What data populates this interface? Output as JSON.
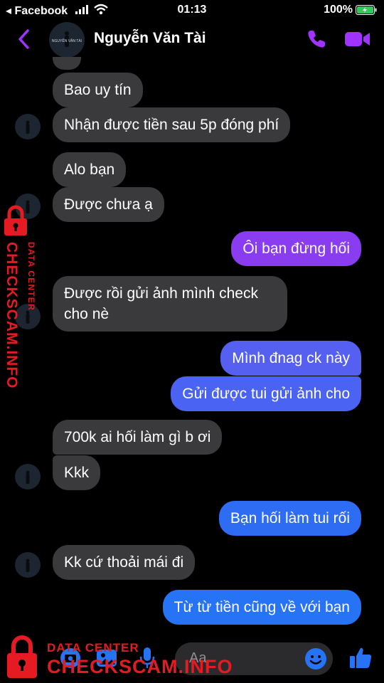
{
  "status_bar": {
    "back_app": "◂ Facebook",
    "time": "01:13",
    "battery": "100%"
  },
  "header": {
    "contact_name": "Nguyễn Văn Tài",
    "avatar_text": "NGUYỄN VĂN TÀI"
  },
  "messages": [
    {
      "side": "in",
      "text": "Bao uy tín"
    },
    {
      "side": "in",
      "text": "Nhận được tiền sau 5p đóng phí"
    },
    {
      "side": "in",
      "text": "Alo bạn"
    },
    {
      "side": "in",
      "text": "Được chưa ạ"
    },
    {
      "side": "out",
      "text": "Ôi bạn đừng hối"
    },
    {
      "side": "in",
      "text": "Được rồi gửi ảnh mình check cho nè"
    },
    {
      "side": "out",
      "text": "Mình đnag ck này"
    },
    {
      "side": "out",
      "text": "Gửi được tui gửi ảnh cho"
    },
    {
      "side": "in",
      "text": "700k ai hối làm gì b ơi"
    },
    {
      "side": "in",
      "text": "Kkk"
    },
    {
      "side": "out",
      "text": "Bạn hối làm tui rối"
    },
    {
      "side": "in",
      "text": "Kk cứ thoải mái đi"
    },
    {
      "side": "out",
      "text": "Từ từ tiền cũng về với bạn"
    }
  ],
  "composer": {
    "placeholder": "Aa"
  },
  "watermark": {
    "line1": "DATA CENTER",
    "line2": "CHECKSCAM.INFO"
  },
  "colors": {
    "accent": "#a033ff",
    "outgoing_top": "#8a3cf0",
    "outgoing_bottom": "#2673f5",
    "incoming": "#3a3a3c",
    "watermark": "#e41b23",
    "battery": "#34c759"
  },
  "icons": [
    "back-chevron-icon",
    "phone-icon",
    "video-camera-icon",
    "camera-icon",
    "photo-icon",
    "microphone-icon",
    "emoji-icon",
    "thumbs-up-icon"
  ]
}
